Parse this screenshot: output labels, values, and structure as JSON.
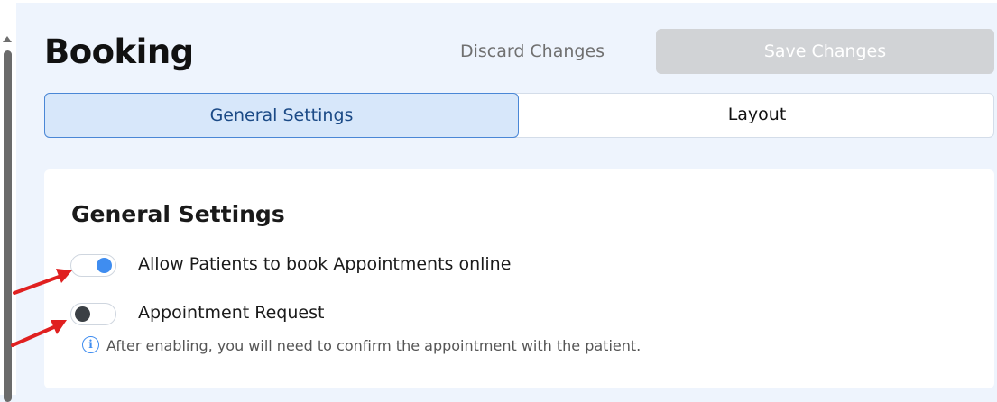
{
  "header": {
    "title": "Booking",
    "discard_label": "Discard Changes",
    "save_label": "Save Changes"
  },
  "tabs": [
    {
      "label": "General Settings",
      "active": true
    },
    {
      "label": "Layout",
      "active": false
    }
  ],
  "section": {
    "title": "General Settings",
    "settings": [
      {
        "label": "Allow Patients to book Appointments online",
        "enabled": true
      },
      {
        "label": "Appointment Request",
        "enabled": false
      }
    ],
    "info": "After enabling, you will need to confirm the appointment with the patient."
  },
  "icons": {
    "info": "info-circle-icon",
    "scroll_up": "scroll-up-arrow-icon",
    "annotation_arrow": "red-arrow-icon"
  },
  "colors": {
    "accent": "#3f8df0",
    "active_tab_bg": "#d7e7fa",
    "save_disabled": "#d1d3d6",
    "annotation": "#e02020"
  }
}
